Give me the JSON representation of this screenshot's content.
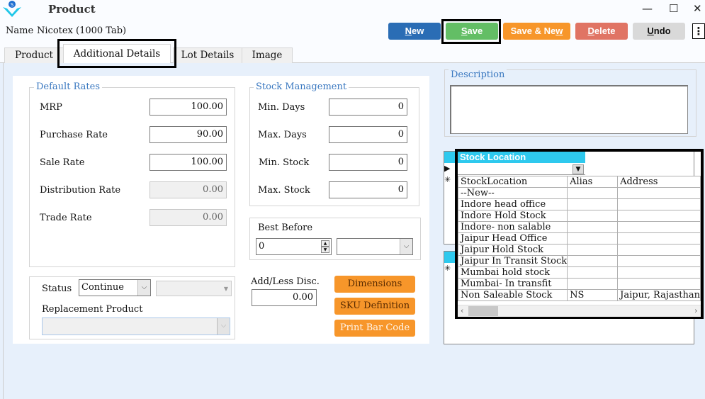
{
  "window": {
    "title": "Product",
    "controls": {
      "minimize": "—",
      "maximize": "☐",
      "close": "✕"
    }
  },
  "header": {
    "name_label": "Name",
    "name_value": "Nicotex (1000 Tab)"
  },
  "toolbar": {
    "new": {
      "pre": "",
      "u": "N",
      "post": "ew"
    },
    "save": {
      "pre": "",
      "u": "S",
      "post": "ave"
    },
    "save_new": {
      "pre": "Save & Ne",
      "u": "w",
      "post": ""
    },
    "delete": {
      "pre": "",
      "u": "D",
      "post": "elete"
    },
    "undo": {
      "pre": "",
      "u": "U",
      "post": "ndo"
    },
    "more": "⋮",
    "colors": {
      "new": "#2a6db5",
      "save": "#63be65",
      "save_new": "#f7962a",
      "delete": "#e07464",
      "undo": "#d9d9d9"
    }
  },
  "tabs": [
    {
      "label": "Product"
    },
    {
      "label": "Additional Details",
      "active": true
    },
    {
      "label": "Lot Details"
    },
    {
      "label": "Image"
    }
  ],
  "default_rates": {
    "title": "Default Rates",
    "fields": [
      {
        "label": "MRP",
        "value": "100.00",
        "disabled": false
      },
      {
        "label": "Purchase Rate",
        "value": "90.00",
        "disabled": false
      },
      {
        "label": "Sale Rate",
        "value": "100.00",
        "disabled": false
      },
      {
        "label": "Distribution Rate",
        "value": "0.00",
        "disabled": true
      },
      {
        "label": "Trade Rate",
        "value": "0.00",
        "disabled": true
      }
    ]
  },
  "stock_management": {
    "title": "Stock Management",
    "fields": [
      {
        "label": "Min. Days",
        "value": "0"
      },
      {
        "label": "Max. Days",
        "value": "0"
      },
      {
        "label": "Min. Stock",
        "value": "0"
      },
      {
        "label": "Max. Stock",
        "value": "0"
      }
    ]
  },
  "best_before": {
    "label": "Best Before",
    "value": "0",
    "unit": ""
  },
  "status": {
    "label": "Status",
    "value": "Continue",
    "secondary": "",
    "replacement_label": "Replacement Product",
    "replacement_value": ""
  },
  "discount": {
    "label": "Add/Less Disc.",
    "value": "0.00"
  },
  "action_buttons": {
    "dimensions": "Dimensions",
    "sku": "SKU Definition",
    "barcode": "Print Bar Code"
  },
  "description": {
    "label": "Description",
    "value": ""
  },
  "stock_location_dropdown": {
    "title": "Stock Location",
    "value": "",
    "columns": [
      "StockLocation",
      "Alias",
      "Address"
    ],
    "rows": [
      [
        "--New--",
        "",
        ""
      ],
      [
        "Indore head office",
        "",
        ""
      ],
      [
        "Indore Hold Stock",
        "",
        ""
      ],
      [
        "Indore- non salable",
        "",
        ""
      ],
      [
        "Jaipur Head Office",
        "",
        ""
      ],
      [
        "Jaipur Hold Stock",
        "",
        ""
      ],
      [
        "Jaipur In Transit Stock",
        "",
        ""
      ],
      [
        "Mumbai hold stock",
        "",
        ""
      ],
      [
        "Mumbai- In transfit",
        "",
        ""
      ],
      [
        "Non Saleable Stock",
        "NS",
        "Jaipur, Rajasthan"
      ]
    ]
  },
  "grid_markers": {
    "current": "▶",
    "new": "✳"
  }
}
